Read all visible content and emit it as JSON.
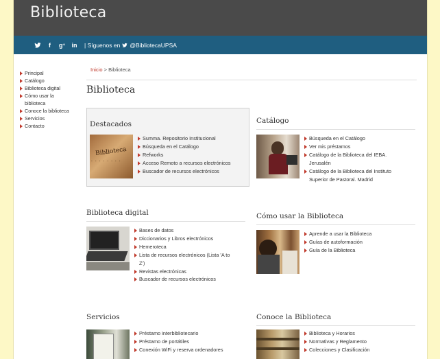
{
  "header": {
    "title": "Biblioteca"
  },
  "social": {
    "follow_text": "| Síguenos en",
    "handle": "@BibliotecaUPSA",
    "icons": [
      "twitter-icon",
      "facebook-icon",
      "google-plus-icon",
      "linkedin-icon"
    ],
    "color": "#1f5e80"
  },
  "sidebar": {
    "items": [
      {
        "label": "Principal"
      },
      {
        "label": "Catálogo"
      },
      {
        "label": "Biblioteca digital"
      },
      {
        "label": "Cómo usar la"
      },
      {
        "label": "biblioteca",
        "continuation": true
      },
      {
        "label": "Conoce la biblioteca"
      },
      {
        "label": "Servicios"
      },
      {
        "label": "Contacto"
      }
    ]
  },
  "breadcrumb": {
    "home": "Inicio",
    "separator": ">",
    "current": "Biblioteca"
  },
  "page_title": "Biblioteca",
  "sections": {
    "destacados": {
      "title": "Destacados",
      "thumb_text": "Biblioteca",
      "links": [
        "Summa. Repositorio Institucional",
        "Búsqueda en el Catálogo",
        "Refworks",
        "Acceso Remoto a recursos electrónicos",
        "Buscador de recursos electrónicos"
      ]
    },
    "catalogo": {
      "title": "Catálogo",
      "links": [
        "Búsqueda en el Catálogo",
        "Ver mis préstamos",
        "Catálogo de la Biblioteca del IEBA.",
        "Jerusalén",
        "Catálogo de la Biblioteca del Instituto",
        "Superior de Pastoral. Madrid"
      ]
    },
    "digital": {
      "title": "Biblioteca digital",
      "links": [
        "Bases de datos",
        "Diccionarios y Libros electrónicos",
        "Hemeroteca",
        "Lista de recursos electrónicos (Lista 'A to",
        "Z')",
        "Revistas electrónicas",
        "Buscador de recursos electrónicos"
      ]
    },
    "como_usar": {
      "title": "Cómo usar la Biblioteca",
      "links": [
        "Aprende a usar la Biblioteca",
        "Guías de autoformación",
        "Guía de la Biblioteca"
      ]
    },
    "servicios": {
      "title": "Servicios",
      "links": [
        "Préstamo interbibliotecario",
        "Préstamo de portátiles",
        "Conexión WiFi y reserva ordenadores"
      ]
    },
    "conoce": {
      "title": "Conoce la Biblioteca",
      "links": [
        "Biblioteca y Horarios",
        "Normativas y Reglamento",
        "Colecciones y Clasificación"
      ]
    }
  },
  "colors": {
    "accent": "#c0392b",
    "header_bg": "#4a4a4a",
    "page_bg": "#fdf8c6"
  }
}
